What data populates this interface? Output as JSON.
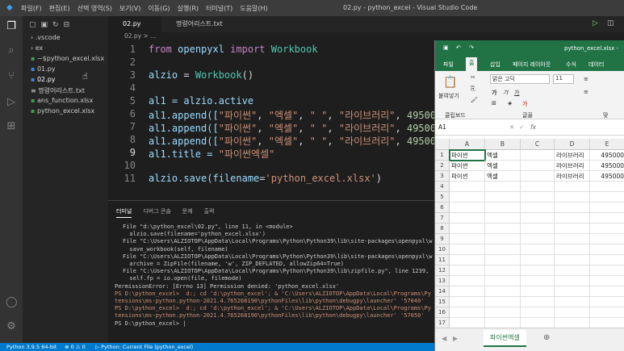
{
  "window": {
    "title": "02.py - python_excel - Visual Studio Code",
    "menu": [
      "파일(F)",
      "편집(E)",
      "선택 영역(S)",
      "보기(V)",
      "이동(G)",
      "실행(R)",
      "터미널(T)",
      "도움말(H)"
    ]
  },
  "explorer": {
    "items": [
      ".vscode",
      "ex",
      "~$python_excel.xlsx",
      "01.py",
      "02.py",
      "명령어리스트.txt",
      "ans_function.xlsx",
      "python_excel.xlsx"
    ]
  },
  "tabs": [
    "02.py",
    "명령어리스트.txt"
  ],
  "breadcrumb": "02.py > ...",
  "editor": {
    "line_numbers": [
      "1",
      "2",
      "3",
      "4",
      "5",
      "6",
      "7",
      "8",
      "9",
      "10",
      "11"
    ],
    "l1_from": "from",
    "l1_mod": "openpyxl",
    "l1_import": "import",
    "l1_cls": "Workbook",
    "l3_var": "alzio",
    "l3_eq": " = ",
    "l3_fn": "Workbook",
    "l3_paren": "()",
    "l5": "al1 = alzio.active",
    "append": "al1.append([",
    "s1": "\"파이썬\"",
    "comma": ", ",
    "s2": "\"엑셀\"",
    "s3": "\" \"",
    "s4": "\"라이브러리\"",
    "num": "495000",
    "l9_a": "al1.title = ",
    "l9_s": "\"파이썬엑셀\"",
    "l11_a": "alzio.save(",
    "l11_k": "filename",
    "l11_eq": "=",
    "l11_s": "'python_excel.xlsx'",
    "l11_c": ")"
  },
  "panel": {
    "tabs": [
      "터미널",
      "디버그 콘솔",
      "문제",
      "출력"
    ],
    "lines": [
      "File \"d:\\python_excel\\02.py\", line 11, in <module>",
      "  alzio.save(filename='python_excel.xlsx')",
      "File \"C:\\Users\\ALZIOTOP\\AppData\\Local\\Programs\\Python\\Python39\\lib\\site-packages\\openpyxl\\w",
      "  save_workbook(self, filename)",
      "File \"C:\\Users\\ALZIOTOP\\AppData\\Local\\Programs\\Python\\Python39\\lib\\site-packages\\openpyxl\\w",
      "  archive = ZipFile(filename, 'w', ZIP_DEFLATED, allowZip64=True)",
      "File \"C:\\Users\\ALZIOTOP\\AppData\\Local\\Programs\\Python\\Python39\\lib\\zipfile.py\", line 1239,",
      "  self.fp = io.open(file, filemode)",
      "PermissionError: [Errno 13] Permission denied: 'python_excel.xlsx'",
      "PS D:\\python_excel>  d:; cd 'd:\\python_excel'; & 'C:\\Users\\ALZIOTOP\\AppData\\Local\\Programs\\Py",
      "tensions\\ms-python.python-2021.4.765268190\\pythonFiles\\lib\\python\\debugpy\\launcher' '57040'",
      "PS D:\\python_excel>  d:; cd 'd:\\python_excel'; & 'C:\\Users\\ALZIOTOP\\AppData\\Local\\Programs\\Py",
      "tensions\\ms-python.python-2021.4.765268190\\pythonFiles\\lib\\python\\debugpy\\launcher' '57050'",
      "PS D:\\python_excel> |"
    ]
  },
  "status": {
    "python": "Python 3.9.5 64-bit",
    "problems": "⊗ 0 ⚠ 0",
    "run": "▷ Python: Current File (python_excel)"
  },
  "excel": {
    "title": "python_excel.xlsx -",
    "ribbon_tabs": [
      "파일",
      "홈",
      "삽입",
      "페이지 레이아웃",
      "수식",
      "데이터"
    ],
    "paste": "붙여넣기",
    "clipboard": "클립보드",
    "font_name": "맑은 고딕",
    "font_size": "11",
    "font_group": "글꼴",
    "align_group": "맞",
    "namebox": "A1",
    "fx": "fx",
    "cols": [
      "A",
      "B",
      "C",
      "D",
      "E"
    ],
    "rows": [
      "1",
      "2",
      "3",
      "4",
      "5",
      "6",
      "7",
      "8",
      "9",
      "10",
      "11",
      "12",
      "13",
      "14",
      "15",
      "16",
      "17"
    ],
    "data": [
      [
        "파이썬",
        "엑셀",
        "",
        "라이브러리",
        "495000"
      ],
      [
        "파이썬",
        "엑셀",
        "",
        "라이브러리",
        "495000"
      ],
      [
        "파이썬",
        "엑셀",
        "",
        "라이브러리",
        "495000"
      ]
    ],
    "sheet": "파이썬엑셀",
    "add": "⊕"
  }
}
